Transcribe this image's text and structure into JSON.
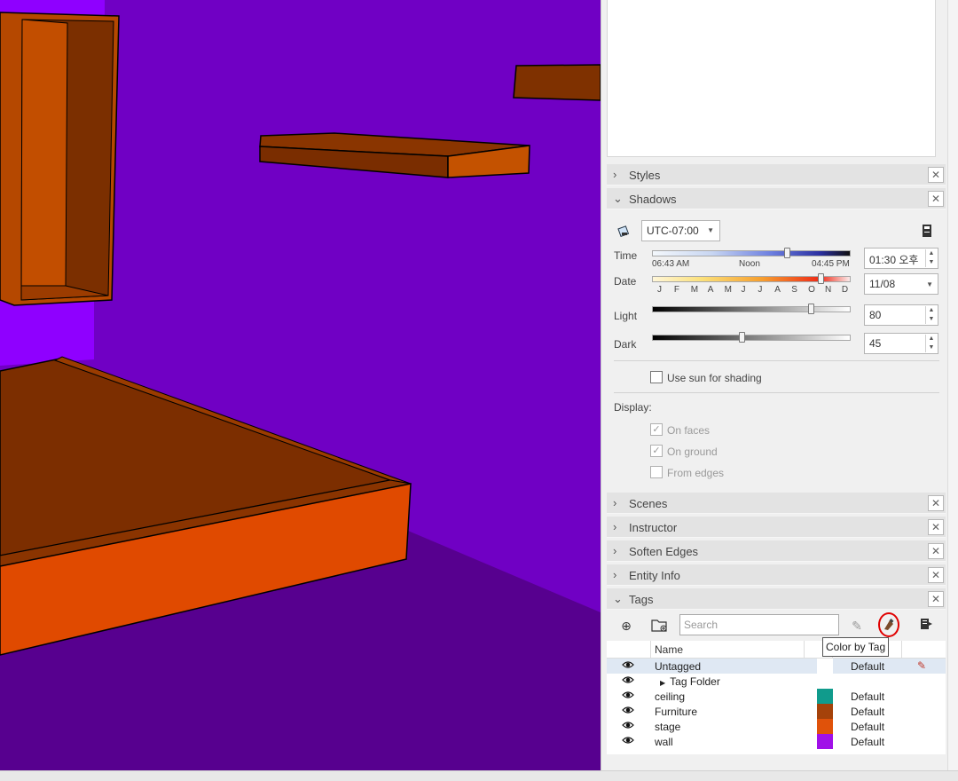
{
  "panels": {
    "styles": {
      "title": "Styles",
      "close": "✕"
    },
    "shadows": {
      "title": "Shadows",
      "close": "✕"
    },
    "scenes": {
      "title": "Scenes",
      "close": "✕"
    },
    "instructor": {
      "title": "Instructor",
      "close": "✕"
    },
    "soften_edges": {
      "title": "Soften Edges",
      "close": "✕"
    },
    "entity_info": {
      "title": "Entity Info",
      "close": "✕"
    },
    "tags": {
      "title": "Tags",
      "close": "✕"
    }
  },
  "shadows": {
    "timezone": "UTC-07:00",
    "time_label": "Time",
    "time_start": "06:43 AM",
    "time_mid": "Noon",
    "time_end": "04:45 PM",
    "time_value": "01:30 오후",
    "time_level": 0.68,
    "date_label": "Date",
    "months": [
      "J",
      "F",
      "M",
      "A",
      "M",
      "J",
      "J",
      "A",
      "S",
      "O",
      "N",
      "D"
    ],
    "date_value": "11/08",
    "date_level": 0.85,
    "light_label": "Light",
    "light_value": "80",
    "dark_label": "Dark",
    "dark_value": "45",
    "use_sun_label": "Use sun for shading",
    "use_sun_checked": false,
    "display_label": "Display:",
    "on_faces_label": "On faces",
    "on_faces_checked": true,
    "on_ground_label": "On ground",
    "on_ground_checked": true,
    "from_edges_label": "From edges",
    "from_edges_checked": false
  },
  "tags": {
    "search_placeholder": "Search",
    "tooltip": "Color by Tag",
    "col_name": "Name",
    "rows": [
      {
        "name": "Untagged",
        "linestyle": "Default",
        "color": "#ffffff",
        "selected": true
      },
      {
        "name": "Tag Folder",
        "linestyle": "",
        "color": "",
        "folder": true
      },
      {
        "name": "ceiling",
        "linestyle": "Default",
        "color": "#109b8c"
      },
      {
        "name": "Furniture",
        "linestyle": "Default",
        "color": "#a5420a"
      },
      {
        "name": "stage",
        "linestyle": "Default",
        "color": "#e0520a"
      },
      {
        "name": "wall",
        "linestyle": "Default",
        "color": "#a010e8"
      }
    ]
  },
  "icons": {
    "chevron_right": "›",
    "chevron_down": "⌄",
    "eye": "👁",
    "folder_arrow": "▶",
    "spin_up": "▲",
    "spin_down": "▼",
    "dropdown": "▼",
    "check": "✓",
    "add": "⊕",
    "pencil": "✎"
  },
  "colors": {
    "wall": "#6f00c4",
    "floor": "#5a0090",
    "furniture_dark": "#7a2e00",
    "furniture_light": "#c24800",
    "stage_front": "#e04a00",
    "selection": "#dfe8f3"
  }
}
